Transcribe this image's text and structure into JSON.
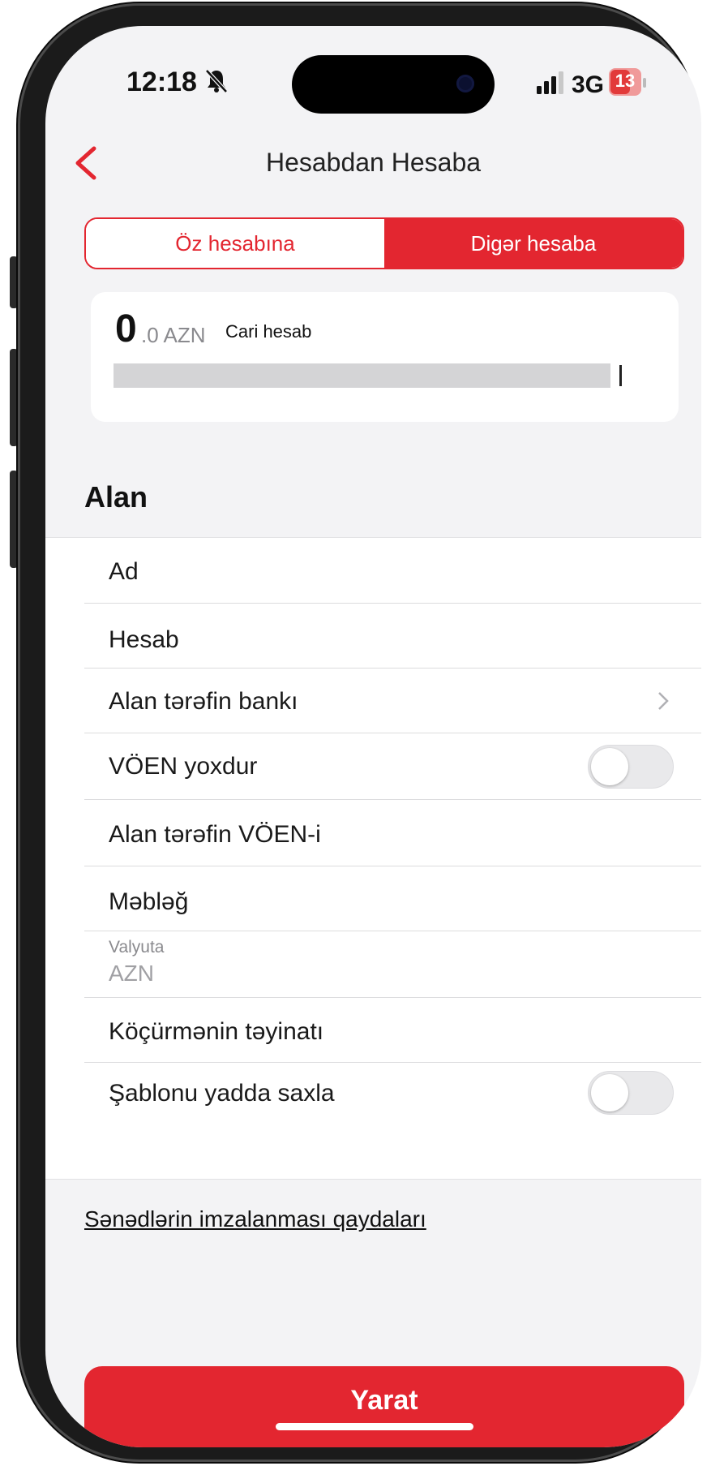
{
  "status_bar": {
    "time": "12:18",
    "network": "3G",
    "battery": "13"
  },
  "nav": {
    "title": "Hesabdan Hesaba"
  },
  "segmented": {
    "left": "Öz hesabına",
    "right": "Digər hesaba",
    "selected": "right"
  },
  "account": {
    "balance_int": "0",
    "balance_rest": ".0 AZN",
    "type": "Cari hesab"
  },
  "section_title": "Alan",
  "form": {
    "name": "Ad",
    "account": "Hesab",
    "bank": "Alan tərəfin bankı",
    "no_voen": "VÖEN yoxdur",
    "voen": "Alan tərəfin VÖEN-i",
    "amount": "Məbləğ",
    "currency_label": "Valyuta",
    "currency_value": "AZN",
    "purpose": "Köçürmənin təyinatı",
    "save_template": "Şablonu yadda saxla",
    "no_voen_on": false,
    "save_template_on": false
  },
  "rules_link": "Sənədlərin imzalanması qaydaları",
  "submit_button": "Yarat",
  "colors": {
    "accent": "#e32630",
    "background": "#f3f3f5"
  }
}
